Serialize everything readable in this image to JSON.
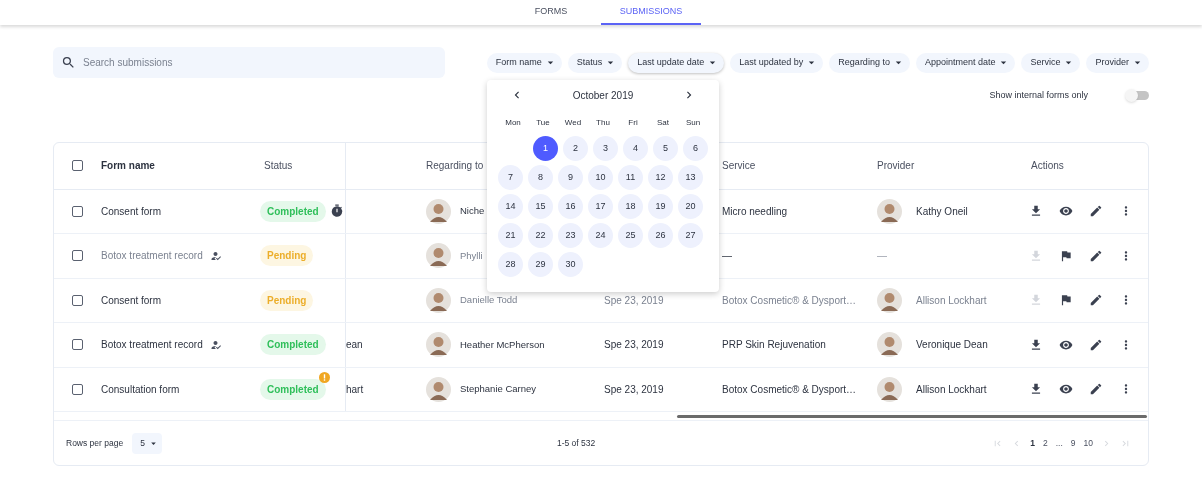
{
  "tabs": [
    {
      "label": "FORMS",
      "selected": false
    },
    {
      "label": "SUBMISSIONS",
      "selected": true
    }
  ],
  "search": {
    "placeholder": "Search submissions"
  },
  "filters": [
    {
      "label": "Form name",
      "open": false
    },
    {
      "label": "Status",
      "open": false
    },
    {
      "label": "Last update date",
      "open": true
    },
    {
      "label": "Last updated by",
      "open": false
    },
    {
      "label": "Regarding to",
      "open": false
    },
    {
      "label": "Appointment date",
      "open": false
    },
    {
      "label": "Service",
      "open": false
    },
    {
      "label": "Provider",
      "open": false
    }
  ],
  "internal_toggle": {
    "label": "Show internal forms only",
    "on": false
  },
  "calendar": {
    "title": "October 2019",
    "weekdays": [
      "Mon",
      "Tue",
      "Wed",
      "Thu",
      "Fri",
      "Sat",
      "Sun"
    ],
    "weeks": [
      [
        {
          "day": "1",
          "selected": true
        },
        {
          "day": "2",
          "selected": false
        },
        {
          "day": "3",
          "selected": false
        },
        {
          "day": "4",
          "selected": false
        },
        {
          "day": "5",
          "selected": false
        },
        {
          "day": "6",
          "selected": false
        }
      ],
      [
        {
          "day": "7",
          "selected": false
        },
        {
          "day": "8",
          "selected": false
        },
        {
          "day": "9",
          "selected": false
        },
        {
          "day": "10",
          "selected": false
        },
        {
          "day": "11",
          "selected": false
        },
        {
          "day": "12",
          "selected": false
        },
        {
          "day": "13",
          "selected": false
        }
      ],
      [
        {
          "day": "14",
          "selected": false
        },
        {
          "day": "15",
          "selected": false
        },
        {
          "day": "16",
          "selected": false
        },
        {
          "day": "17",
          "selected": false
        },
        {
          "day": "18",
          "selected": false
        },
        {
          "day": "19",
          "selected": false
        },
        {
          "day": "20",
          "selected": false
        }
      ],
      [
        {
          "day": "21",
          "selected": false
        },
        {
          "day": "22",
          "selected": false
        },
        {
          "day": "23",
          "selected": false
        },
        {
          "day": "24",
          "selected": false
        },
        {
          "day": "25",
          "selected": false
        },
        {
          "day": "26",
          "selected": false
        },
        {
          "day": "27",
          "selected": false
        }
      ],
      [
        {
          "day": "28",
          "selected": false
        },
        {
          "day": "29",
          "selected": false
        },
        {
          "day": "30",
          "selected": false
        }
      ]
    ]
  },
  "table": {
    "columns": [
      "Form name",
      "Status",
      "Regarding to",
      "Service",
      "Provider",
      "Actions"
    ],
    "header_checked": false,
    "rows": [
      {
        "checked": false,
        "form_name": "Consent form",
        "muted": false,
        "signed": false,
        "status": {
          "label": "Completed",
          "kind": "completed"
        },
        "timer": true,
        "alert": false,
        "regarding": "Niche",
        "service": "Micro needling",
        "provider": "Kathy Oneil",
        "provider_avatar": true,
        "muted_right": false,
        "actions": {
          "download_enabled": true,
          "kind": "view"
        }
      },
      {
        "checked": false,
        "form_name": "Botox treatment record",
        "muted": true,
        "signed": true,
        "status": {
          "label": "Pending",
          "kind": "pending"
        },
        "timer": false,
        "alert": false,
        "regarding": "Phylli",
        "service": "—",
        "provider": "—",
        "provider_avatar": false,
        "muted_right": false,
        "actions": {
          "download_enabled": false,
          "kind": "flag"
        }
      },
      {
        "checked": false,
        "form_name": "Consent form",
        "muted": false,
        "signed": false,
        "status": {
          "label": "Pending",
          "kind": "pending"
        },
        "timer": false,
        "alert": false,
        "regarding": "Danielle Todd",
        "date": "Spe 23, 2019",
        "service": "Botox Cosmetic® & Dysport…",
        "provider": "Allison Lockhart",
        "provider_avatar": true,
        "muted_right": true,
        "actions": {
          "download_enabled": false,
          "kind": "flag"
        }
      },
      {
        "checked": false,
        "form_name": "Botox treatment record",
        "muted": false,
        "signed": true,
        "status": {
          "label": "Completed",
          "kind": "completed"
        },
        "timer": false,
        "alert": false,
        "column_3": "ean",
        "regarding": "Heather McPherson",
        "date": "Spe 23, 2019",
        "service": "PRP Skin Rejuvenation",
        "provider": "Veronique Dean",
        "provider_avatar": true,
        "muted_right": false,
        "actions": {
          "download_enabled": true,
          "kind": "view"
        }
      },
      {
        "checked": false,
        "form_name": "Consultation form",
        "muted": false,
        "signed": false,
        "status": {
          "label": "Completed",
          "kind": "completed"
        },
        "timer": false,
        "alert": true,
        "column_3": "hart",
        "regarding": "Stephanie Carney",
        "date": "Spe 23, 2019",
        "service": "Botox Cosmetic® & Dysport…",
        "provider": "Allison Lockhart",
        "provider_avatar": true,
        "muted_right": false,
        "actions": {
          "download_enabled": true,
          "kind": "view"
        }
      }
    ]
  },
  "footer": {
    "rows_per_page_label": "Rows per page",
    "rows_per_page": "5",
    "range": "1-5 of 532",
    "pages": [
      {
        "label": "1",
        "selected": true
      },
      {
        "label": "2",
        "selected": false
      },
      {
        "label": "...",
        "selected": false
      },
      {
        "label": "9",
        "selected": false
      },
      {
        "label": "10",
        "selected": false
      }
    ]
  }
}
